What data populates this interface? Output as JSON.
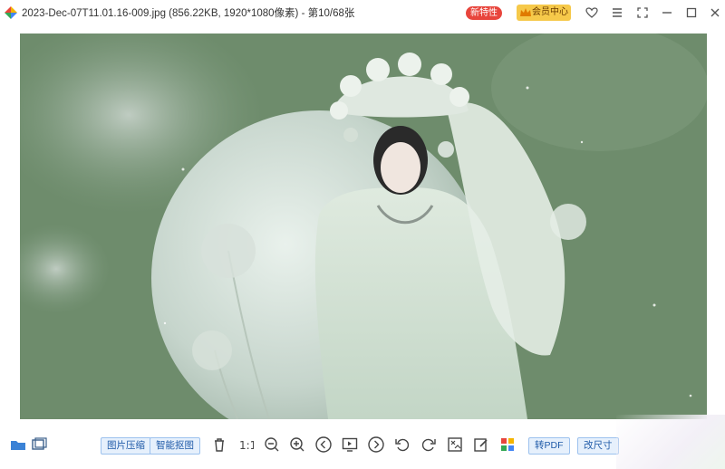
{
  "titlebar": {
    "title": "2023-Dec-07T11.01.16-009.jpg (856.22KB, 1920*1080像素) - 第10/68张",
    "badge_new": "新特性",
    "vip_label": "会员中心",
    "icons": [
      "app-logo-icon",
      "heart-icon",
      "menu-icon",
      "fullscreen-icon",
      "minimize-icon",
      "maximize-icon",
      "close-icon"
    ]
  },
  "viewer": {
    "image_description_icon": "photo"
  },
  "toolbar": {
    "compress_label": "图片压缩",
    "cutout_label": "智能抠图",
    "to_pdf_label": "转PDF",
    "resize_label": "改尺寸",
    "icons": [
      "folder-icon",
      "gallery-icon",
      "delete-icon",
      "actual-size-icon",
      "zoom-out-icon",
      "zoom-in-icon",
      "prev-icon",
      "slideshow-icon",
      "next-icon",
      "rotate-left-icon",
      "rotate-right-icon",
      "crop-icon",
      "edit-icon",
      "apps-icon"
    ]
  },
  "colors": {
    "accent_blue": "#1f5aa8",
    "badge_red": "#e8453c",
    "vip_gold": "#f6c94a",
    "photo_bg": "#6b8a6a"
  }
}
